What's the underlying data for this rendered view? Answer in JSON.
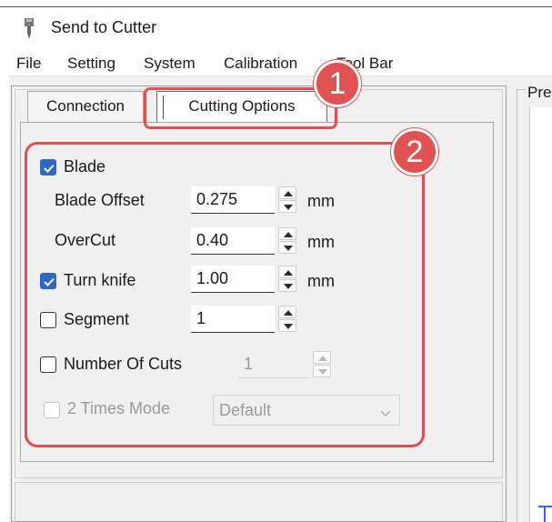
{
  "window": {
    "title": "Send to Cutter"
  },
  "menu": {
    "items": [
      "File",
      "Setting",
      "System",
      "Calibration",
      "Tool Bar"
    ]
  },
  "tabs": {
    "connection": "Connection",
    "cutting_options": "Cutting Options"
  },
  "preview": {
    "label": "Pre"
  },
  "callouts": {
    "one": "1",
    "two": "2"
  },
  "options": {
    "blade": {
      "label": "Blade",
      "checked": true
    },
    "blade_offset": {
      "label": "Blade Offset",
      "value": "0.275",
      "unit": "mm"
    },
    "overcut": {
      "label": "OverCut",
      "value": "0.40",
      "unit": "mm"
    },
    "turn_knife": {
      "label": "Turn knife",
      "checked": true,
      "value": "1.00",
      "unit": "mm"
    },
    "segment": {
      "label": "Segment",
      "checked": false,
      "value": "1"
    },
    "number_of_cuts": {
      "label": "Number Of Cuts",
      "checked": false,
      "value": "1",
      "enabled": false
    },
    "two_times_mode": {
      "label": "2 Times Mode",
      "checked": false,
      "selected": "Default",
      "enabled": false
    }
  },
  "colors": {
    "accent": "#2c69c5",
    "callout": "#e04f4f"
  }
}
